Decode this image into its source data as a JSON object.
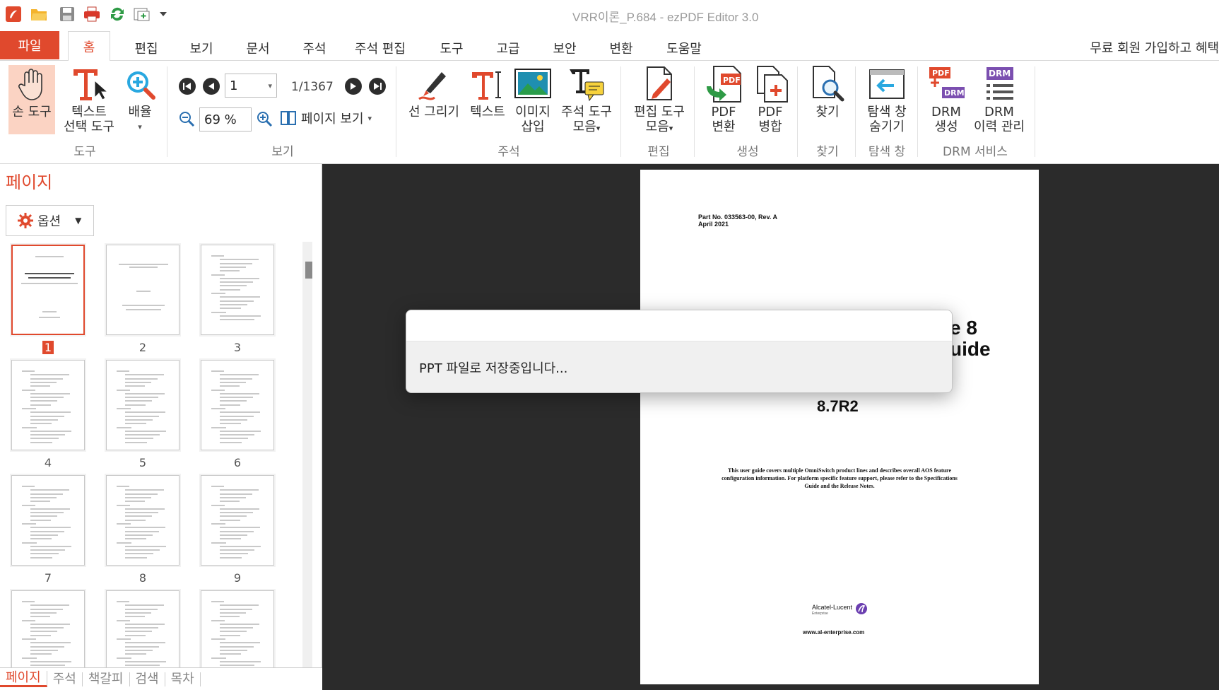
{
  "window": {
    "title": "VRR이론_P.684 -  ezPDF Editor 3.0"
  },
  "quick_access": [
    "app-logo-icon",
    "open-folder-icon",
    "save-icon",
    "print-icon",
    "refresh-icon",
    "new-window-icon",
    "dropdown-arrow-icon"
  ],
  "menu": {
    "file": "파일",
    "tabs": [
      "홈",
      "편집",
      "보기",
      "문서",
      "주석",
      "주석 편집",
      "도구",
      "고급",
      "보안",
      "변환",
      "도움말"
    ],
    "active_tab": "홈",
    "signup": "무료 회원 가입하고 혜택"
  },
  "ribbon": {
    "tools": {
      "group": "도구",
      "hand": "손 도구",
      "text_select_1": "텍스트",
      "text_select_2": "선택 도구",
      "zoom": "배율"
    },
    "view": {
      "group": "보기",
      "page_input": "1",
      "page_count": "1/1367",
      "zoom_value": "69 %",
      "page_view": "페이지 보기"
    },
    "annot": {
      "group": "주석",
      "draw": "선 그리기",
      "text": "텍스트",
      "image_1": "이미지",
      "image_2": "삽입",
      "collect_1": "주석 도구",
      "collect_2": "모음"
    },
    "edit": {
      "group": "편집",
      "tools_1": "편집 도구",
      "tools_2": "모음"
    },
    "create": {
      "group": "생성",
      "convert_1": "PDF",
      "convert_2": "변환",
      "merge_1": "PDF",
      "merge_2": "병합",
      "pdf_badge": "PDF"
    },
    "find": {
      "group": "찾기",
      "find": "찾기"
    },
    "nav": {
      "group": "탐색 창",
      "hide_1": "탐색 창",
      "hide_2": "숨기기"
    },
    "drm": {
      "group": "DRM 서비스",
      "create_1": "DRM",
      "create_2": "생성",
      "history_1": "DRM",
      "history_2": "이력 관리",
      "badge_pdf": "PDF",
      "badge_drm": "DRM"
    }
  },
  "left_pane": {
    "title": "페이지",
    "options": "옵션",
    "thumb_labels": [
      "1",
      "2",
      "3",
      "4",
      "5",
      "6",
      "7",
      "8",
      "9"
    ],
    "bottom_tabs": [
      "페이지",
      "주석",
      "책갈피",
      "검색",
      "목차"
    ]
  },
  "document": {
    "part_no": "Part No. 033563-00, Rev. A",
    "date": "April 2021",
    "title_line1": "e 8",
    "title_line2": "uide",
    "version": "8.7R2",
    "description": [
      "This user guide covers multiple OmniSwitch product lines and describes overall AOS feature",
      "configuration information. For platform specific feature support, please refer to the Specifications",
      "Guide and the Release Notes."
    ],
    "brand": "Alcatel-Lucent",
    "brand_sub": "Enterprise",
    "website": "www.al-enterprise.com"
  },
  "dialog": {
    "message": "PPT 파일로 저장중입니다..."
  },
  "colors": {
    "accent": "#e0492d",
    "viewer_bg": "#2b2b2b",
    "hand_bg": "#fbd3c3"
  }
}
